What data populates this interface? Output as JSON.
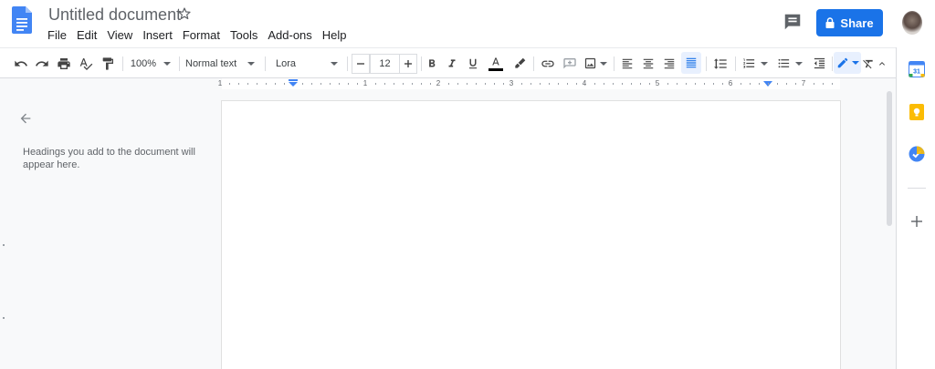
{
  "app": {
    "doc_title": "Untitled document",
    "menu": [
      "File",
      "Edit",
      "View",
      "Insert",
      "Format",
      "Tools",
      "Add-ons",
      "Help"
    ],
    "share_label": "Share",
    "icons": {
      "logo": "docs-logo-icon",
      "star": "star-icon",
      "comments": "comment-icon",
      "share_lock": "lock-icon"
    }
  },
  "toolbar": {
    "zoom": "100%",
    "style": "Normal text",
    "font": "Lora",
    "font_size": "12",
    "text_color": "#000000",
    "accent": "#1a73e8",
    "active_alignment": "justify",
    "mode": "editing"
  },
  "ruler": {
    "labels": [
      "1",
      "1",
      "2",
      "3",
      "4",
      "5",
      "6",
      "7"
    ]
  },
  "outline": {
    "hint": "Headings you add to the document will appear here."
  },
  "side_panel": {
    "calendar_day": "31",
    "items": [
      "calendar-icon",
      "keep-icon",
      "tasks-icon",
      "add-icon"
    ]
  }
}
